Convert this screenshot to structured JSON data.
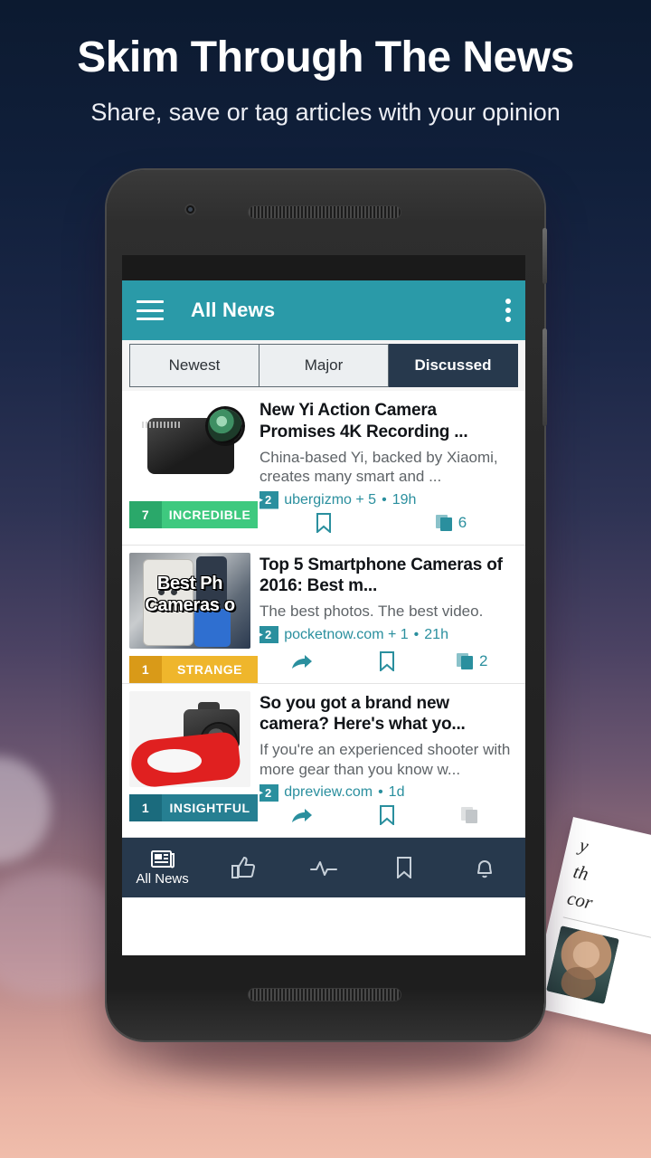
{
  "hero": {
    "headline": "Skim Through The News",
    "subhead": "Share, save or tag articles with your opinion"
  },
  "side_card": {
    "line1": "y",
    "line2": "th",
    "line3": "cor"
  },
  "app": {
    "appbar": {
      "menu_icon": "hamburger-menu-icon",
      "title": "All News",
      "overflow_icon": "overflow-menu-icon"
    },
    "tabs": [
      {
        "label": "Newest",
        "active": false
      },
      {
        "label": "Major",
        "active": false
      },
      {
        "label": "Discussed",
        "active": true
      }
    ],
    "articles": [
      {
        "title": "New Yi Action Camera Promises 4K Recording ...",
        "desc": "China-based Yi, backed by Xiaomi, creates many smart and ...",
        "tag_count": "2",
        "source": "ubergizmo + 5",
        "separator": "•",
        "time": "19h",
        "badge": {
          "count": "7",
          "label": "INCREDIBLE",
          "count_color": "#2aa86a",
          "label_color": "#3ec97f"
        },
        "thumb": "action-camera-thumbnail",
        "actions": {
          "share": false,
          "save": true,
          "copies": true,
          "copies_count": "6",
          "copies_disabled": false
        }
      },
      {
        "title": "Top 5 Smartphone Cameras of 2016: Best m...",
        "desc": "The best photos. The best video.",
        "tag_count": "2",
        "source": "pocketnow.com + 1",
        "separator": "•",
        "time": "21h",
        "badge": {
          "count": "1",
          "label": "STRANGE",
          "count_color": "#d99a18",
          "label_color": "#efb62c"
        },
        "thumb": "smartphone-cameras-video-thumbnail",
        "thumb_overlay_line1": "Best Ph",
        "thumb_overlay_line2": "Cameras o",
        "actions": {
          "share": true,
          "save": true,
          "copies": true,
          "copies_count": "2",
          "copies_disabled": false
        }
      },
      {
        "title": "So you got a brand new camera? Here's what yo...",
        "desc": "If you're an experienced shooter with more gear than you know w...",
        "tag_count": "2",
        "source": "dpreview.com",
        "separator": "•",
        "time": "1d",
        "badge": {
          "count": "1",
          "label": "INSIGHTFUL",
          "count_color": "#1b6b7d",
          "label_color": "#267f92"
        },
        "thumb": "dslr-camera-thumbnail",
        "actions": {
          "share": true,
          "save": true,
          "copies": true,
          "copies_count": "",
          "copies_disabled": true
        }
      }
    ],
    "bottom_nav": [
      {
        "icon": "newspaper-icon",
        "label": "All News",
        "active": true
      },
      {
        "icon": "thumbs-up-icon",
        "label": "",
        "active": false
      },
      {
        "icon": "activity-pulse-icon",
        "label": "",
        "active": false
      },
      {
        "icon": "bookmark-icon",
        "label": "",
        "active": false
      },
      {
        "icon": "bell-icon",
        "label": "",
        "active": false
      }
    ]
  },
  "colors": {
    "appbar_teal": "#2a9aa8",
    "accent_teal": "#2a8f9e",
    "nav_dark": "#27394d",
    "badge_green": "#3ec97f",
    "badge_amber": "#efb62c",
    "badge_steel": "#267f92"
  }
}
